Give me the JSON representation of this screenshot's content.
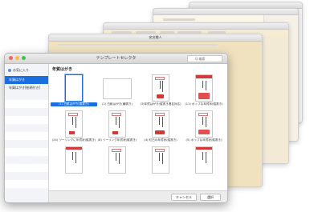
{
  "background_windows": [
    {
      "title": ""
    },
    {
      "title": ""
    },
    {
      "title": ""
    },
    {
      "title": "宛名職人"
    }
  ],
  "window": {
    "title": "テンプレートセレクタ",
    "search_placeholder": "Q 検索"
  },
  "sidebar": {
    "header": "お気に入り",
    "items": [
      {
        "label": "年賀はがき",
        "selected": true
      },
      {
        "label": "年賀はがき[絵柄付き]",
        "selected": false
      }
    ]
  },
  "content": {
    "heading": "年賀はがき",
    "templates": [
      {
        "caption": "(1) 白紙はがき(縦書き)",
        "selected": true
      },
      {
        "caption": "(2) 白紙はがき(横書き)",
        "selected": false
      },
      {
        "caption": "(3)年賀はがき(縦書き連名対応)",
        "selected": false
      },
      {
        "caption": "(11) ポップな年賀状(縦書き)",
        "selected": false
      },
      {
        "caption": "(24) ツーリングに年賀状(縦書き)",
        "selected": false
      },
      {
        "caption": "(8) ツーリング年賀状(縦書き)",
        "selected": false
      },
      {
        "caption": "(4) 紅白の年賀状(縦書き)",
        "selected": false
      },
      {
        "caption": "(5) ポップな年賀状(縦書き)",
        "selected": false
      },
      {
        "caption": "",
        "selected": false
      },
      {
        "caption": "",
        "selected": false
      },
      {
        "caption": "",
        "selected": false
      },
      {
        "caption": "",
        "selected": false
      }
    ]
  },
  "footer": {
    "cancel_label": "キャンセル",
    "select_label": "選択"
  },
  "colors": {
    "accent": "#1a6ede",
    "card_red": "#d43838",
    "close": "#fc615d",
    "minimize": "#fdbc40",
    "zoom": "#34c84a"
  }
}
